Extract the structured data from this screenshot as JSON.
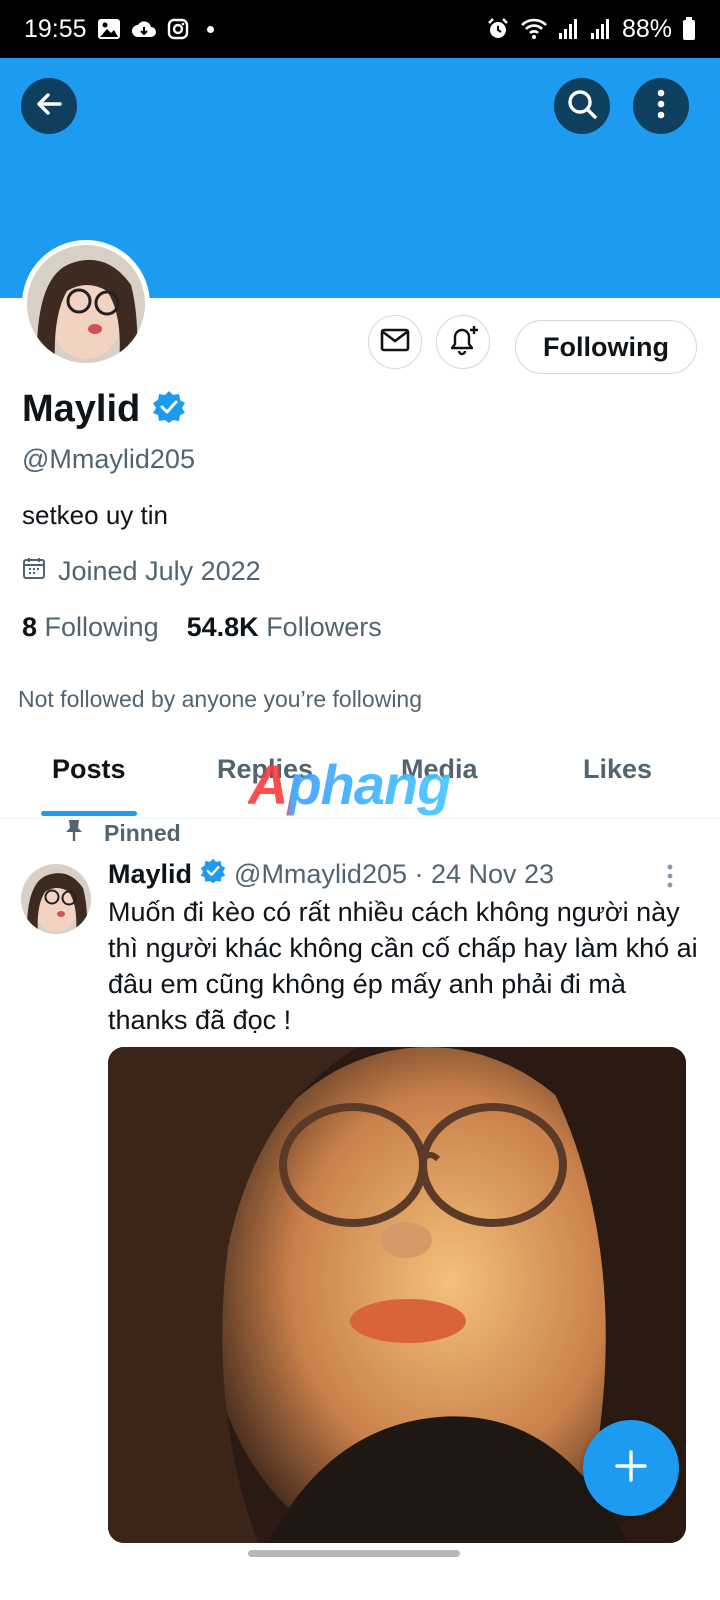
{
  "status_bar": {
    "time": "19:55",
    "battery": "88%",
    "left_icons": [
      "gallery-icon",
      "cloud-icon",
      "instagram-icon",
      "dot-icon"
    ],
    "right_icons": [
      "alarm-icon",
      "wifi-icon",
      "signal-icon",
      "signal-icon",
      "battery-icon"
    ]
  },
  "header": {
    "banner_color": "#1d9bf0",
    "back_icon": "arrow-left-icon",
    "search_icon": "search-icon",
    "more_icon": "more-vertical-icon"
  },
  "profile": {
    "display_name": "Maylid",
    "verified": true,
    "handle": "@Mmaylid205",
    "bio": "setkeo uy tin",
    "joined": "Joined July 2022",
    "following_count": "8",
    "following_label": "Following",
    "followers_count": "54.8K",
    "followers_label": "Followers",
    "followed_by": "Not followed by anyone you’re following"
  },
  "actions": {
    "message_icon": "mail-icon",
    "notify_icon": "bell-plus-icon",
    "follow_button": "Following"
  },
  "tabs": [
    {
      "label": "Posts",
      "active": true
    },
    {
      "label": "Replies",
      "active": false
    },
    {
      "label": "Media",
      "active": false
    },
    {
      "label": "Likes",
      "active": false
    }
  ],
  "watermark": "Aphang",
  "post": {
    "pinned_label": "Pinned",
    "author": "Maylid",
    "handle_date": "@Mmaylid205 · 24 Nov 23",
    "text": "Muốn đi kèo có rất nhiều cách không người này thì người khác không cần cố chấp hay làm khó ai đâu em cũng không ép mấy anh phải đi mà thanks đã đọc !",
    "media": "photo"
  },
  "fab": {
    "icon": "plus-icon"
  },
  "colors": {
    "accent": "#1d9bf0",
    "text_primary": "#0f1419",
    "text_secondary": "#536471"
  }
}
